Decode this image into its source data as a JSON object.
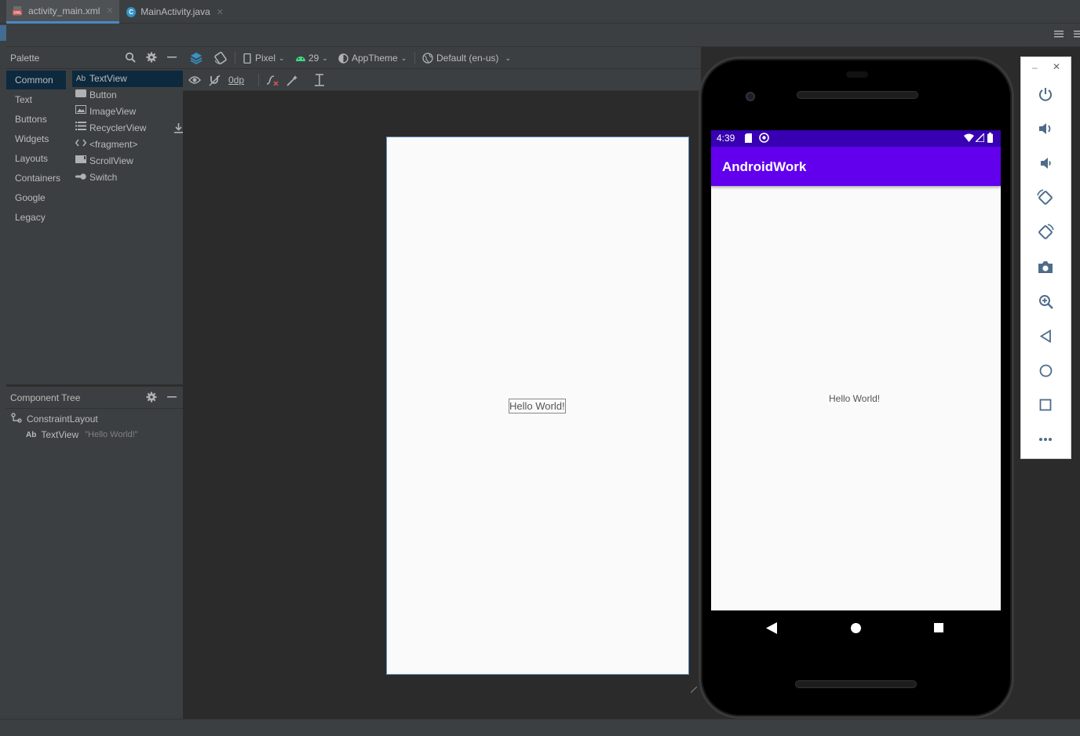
{
  "tabs": [
    {
      "label": "activity_main.xml",
      "active": true
    },
    {
      "label": "MainActivity.java",
      "active": false
    }
  ],
  "palette": {
    "title": "Palette",
    "categories": [
      "Common",
      "Text",
      "Buttons",
      "Widgets",
      "Layouts",
      "Containers",
      "Google",
      "Legacy"
    ],
    "selected_category": "Common",
    "widgets": [
      {
        "icon": "Ab",
        "label": "TextView"
      },
      {
        "icon": "button-icon",
        "label": "Button"
      },
      {
        "icon": "image-icon",
        "label": "ImageView"
      },
      {
        "icon": "list-icon",
        "label": "RecyclerView"
      },
      {
        "icon": "code-icon",
        "label": "<fragment>"
      },
      {
        "icon": "scroll-icon",
        "label": "ScrollView"
      },
      {
        "icon": "switch-icon",
        "label": "Switch"
      }
    ]
  },
  "component_tree": {
    "title": "Component Tree",
    "root": "ConstraintLayout",
    "child_icon": "Ab",
    "child_label": "TextView",
    "child_text": "\"Hello World!\""
  },
  "toolbar": {
    "device": "Pixel",
    "api": "29",
    "theme": "AppTheme",
    "locale": "Default (en-us)",
    "margin": "0dp"
  },
  "blueprint": {
    "text": "Hello World!"
  },
  "emulator": {
    "time": "4:39",
    "app_title": "AndroidWork",
    "content_text": "Hello World!",
    "colors": {
      "status_bar": "#3700b3",
      "app_bar": "#6200ee"
    }
  },
  "emulator_tools": [
    "minimize-icon",
    "close-icon",
    "power-icon",
    "volume-up-icon",
    "volume-down-icon",
    "rotate-left-icon",
    "rotate-right-icon",
    "camera-icon",
    "zoom-icon",
    "back-icon",
    "home-icon",
    "overview-icon",
    "more-icon"
  ]
}
